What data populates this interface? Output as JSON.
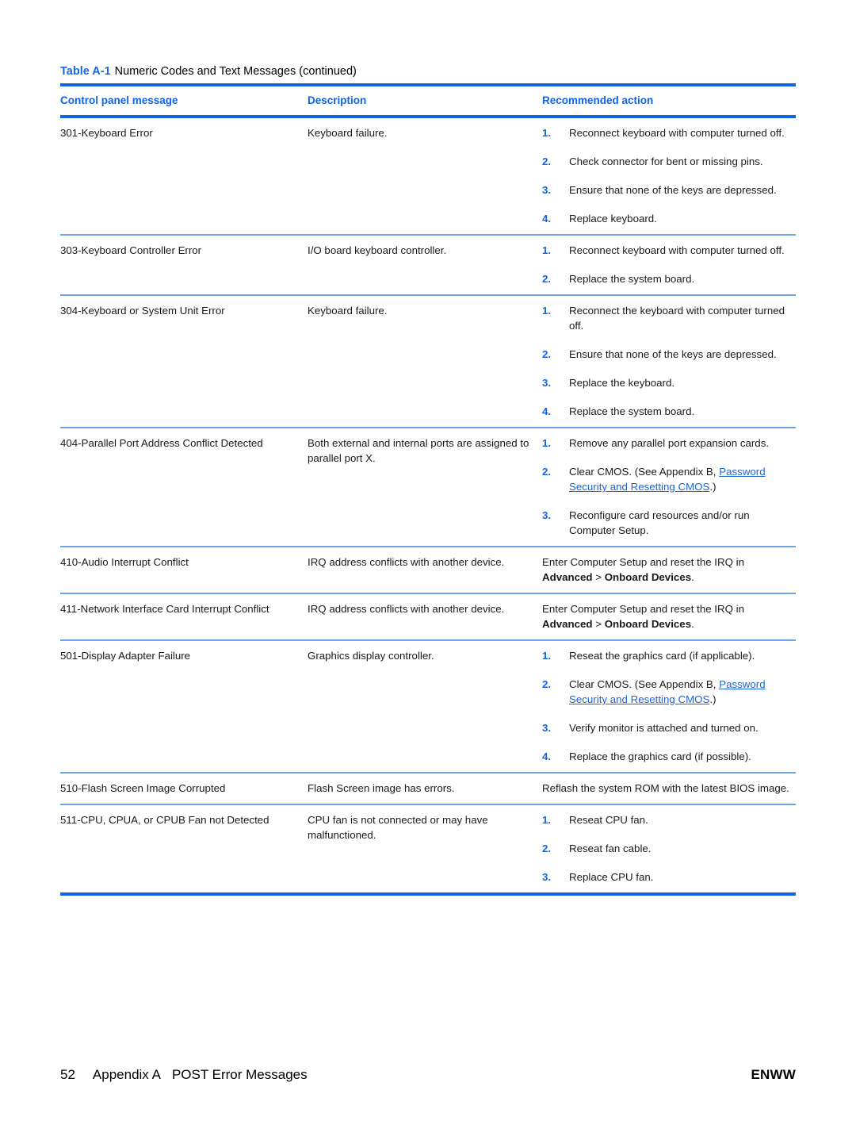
{
  "table": {
    "caption_label": "Table A-1",
    "caption_title": "Numeric Codes and Text Messages (continued)",
    "columns": {
      "message": "Control panel message",
      "description": "Description",
      "action": "Recommended action"
    },
    "rows": [
      {
        "message": "301-Keyboard Error",
        "description": "Keyboard failure.",
        "action_type": "list",
        "actions": [
          "Reconnect keyboard with computer turned off.",
          "Check connector for bent or missing pins.",
          "Ensure that none of the keys are depressed.",
          "Replace keyboard."
        ]
      },
      {
        "message": "303-Keyboard Controller Error",
        "description": "I/O board keyboard controller.",
        "action_type": "list",
        "actions": [
          "Reconnect keyboard with computer turned off.",
          "Replace the system board."
        ]
      },
      {
        "message": "304-Keyboard or System Unit Error",
        "description": "Keyboard failure.",
        "action_type": "list",
        "actions": [
          "Reconnect the keyboard with computer turned off.",
          "Ensure that none of the keys are depressed.",
          "Replace the keyboard.",
          "Replace the system board."
        ]
      },
      {
        "message": "404-Parallel Port Address Conflict Detected",
        "description": "Both external and internal ports are assigned to parallel port X.",
        "action_type": "list",
        "actions": [
          "Remove any parallel port expansion cards.",
          "CMOS_LINK_ITEM",
          "Reconfigure card resources and/or run Computer Setup."
        ],
        "link_item_index": 1,
        "link_prefix": "Clear CMOS. (See Appendix B, ",
        "link_text": "Password Security and Resetting CMOS",
        "link_suffix": ".)"
      },
      {
        "message": "410-Audio Interrupt Conflict",
        "description": "IRQ address conflicts with another device.",
        "action_type": "paragraph",
        "paragraph_prefix": "Enter Computer Setup and reset the IRQ in ",
        "paragraph_bold_1": "Advanced",
        "paragraph_middle": " > ",
        "paragraph_bold_2": "Onboard Devices",
        "paragraph_suffix": "."
      },
      {
        "message": "411-Network Interface Card Interrupt Conflict",
        "description": "IRQ address conflicts with another device.",
        "action_type": "paragraph",
        "paragraph_prefix": "Enter Computer Setup and reset the IRQ in ",
        "paragraph_bold_1": "Advanced",
        "paragraph_middle": " > ",
        "paragraph_bold_2": "Onboard Devices",
        "paragraph_suffix": "."
      },
      {
        "message": "501-Display Adapter Failure",
        "description": "Graphics display controller.",
        "action_type": "list",
        "actions": [
          "Reseat the graphics card (if applicable).",
          "CMOS_LINK_ITEM",
          "Verify monitor is attached and turned on.",
          "Replace the graphics card (if possible)."
        ],
        "link_item_index": 1,
        "link_prefix": "Clear CMOS. (See Appendix B, ",
        "link_text": "Password Security and Resetting CMOS",
        "link_suffix": ".)"
      },
      {
        "message": "510-Flash Screen Image Corrupted",
        "description": "Flash Screen image has errors.",
        "action_type": "plain",
        "plain_action": "Reflash the system ROM with the latest BIOS image."
      },
      {
        "message": "511-CPU, CPUA, or CPUB Fan not Detected",
        "description": "CPU fan is not connected or may have malfunctioned.",
        "action_type": "list",
        "actions": [
          "Reseat CPU fan.",
          "Reseat fan cable.",
          "Replace CPU fan."
        ]
      }
    ]
  },
  "footer": {
    "page_number": "52",
    "appendix": "Appendix A",
    "section_title": "POST Error Messages",
    "imprint": "ENWW"
  },
  "colors": {
    "accent_blue": "#1163E8",
    "rule_light_blue": "#6EA6E4",
    "link_blue": "#1B64D6"
  }
}
